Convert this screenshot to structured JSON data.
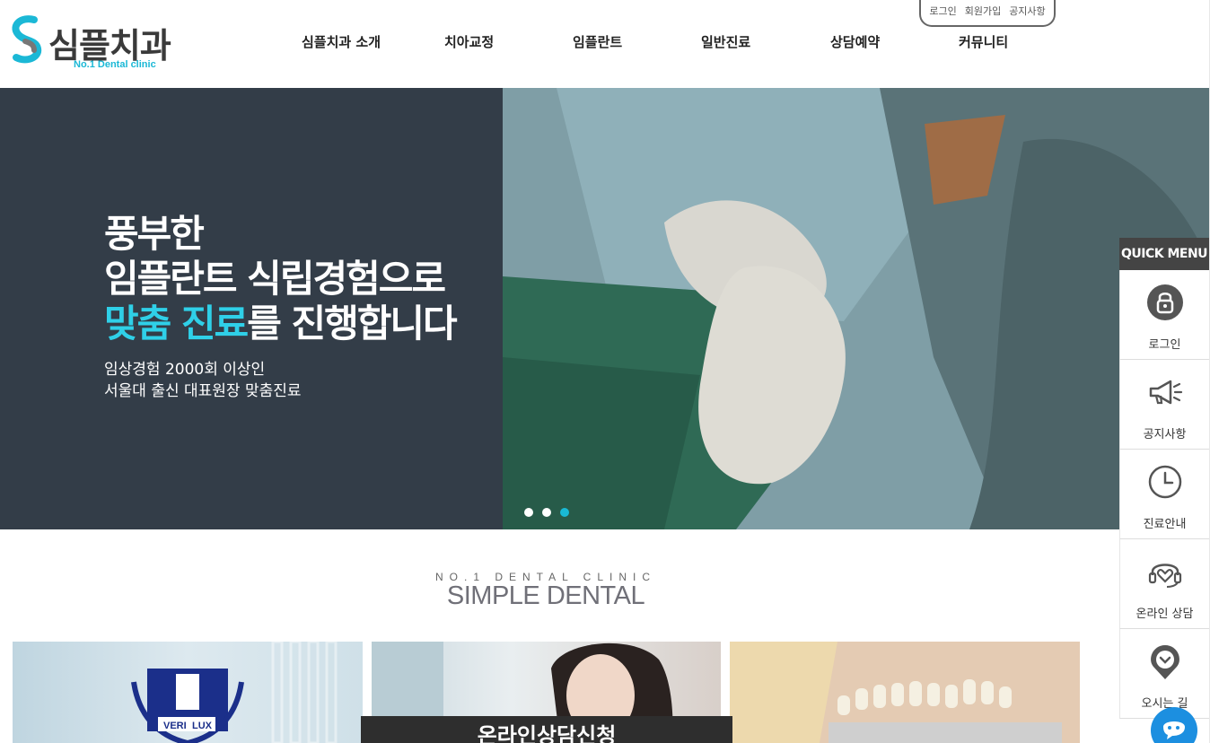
{
  "brand": {
    "name": "심플치과",
    "tagline": "No.1 Dental clinic",
    "accent": "#1bb8d6"
  },
  "util_links": [
    "로그인",
    "회원가입",
    "공지사항"
  ],
  "nav": {
    "items": [
      "심플치과 소개",
      "치아교정",
      "임플란트",
      "일반진료",
      "상담예약",
      "커뮤니티"
    ]
  },
  "hero": {
    "line1": "풍부한",
    "line2": "임플란트 식립경험으로",
    "line3_highlight": "맞춤 진료",
    "line3_rest": "를 진행합니다",
    "sub1": "임상경험 2000회 이상인",
    "sub2": "서울대 출신 대표원장 맞춤진료",
    "slides_total": 3,
    "active_slide": 3
  },
  "section": {
    "eyebrow": "NO.1 DENTAL CLINIC",
    "title": "SIMPLE DENTAL"
  },
  "cards": {
    "banner": "온라인상담신청",
    "seal_lines": [
      "VERI",
      "LUX"
    ]
  },
  "quick_menu": {
    "title": "QUICK MENU",
    "items": [
      {
        "label": "로그인",
        "icon": "lock-icon"
      },
      {
        "label": "공지사항",
        "icon": "megaphone-icon"
      },
      {
        "label": "진료안내",
        "icon": "clock-icon"
      },
      {
        "label": "온라인 상담",
        "icon": "headset-heart-icon"
      },
      {
        "label": "오시는 길",
        "icon": "location-pin-icon"
      }
    ]
  }
}
